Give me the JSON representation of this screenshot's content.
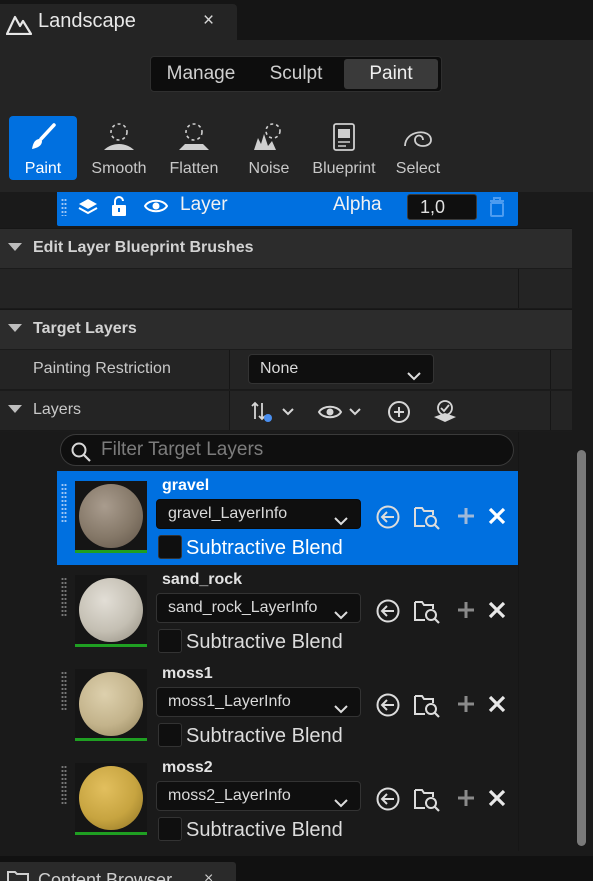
{
  "window": {
    "tab_title": "Landscape",
    "close_glyph": "×",
    "logo_icon": "unreal-logo-icon"
  },
  "modes": {
    "items": [
      "Manage",
      "Sculpt",
      "Paint"
    ],
    "active": "Paint"
  },
  "tools": {
    "items": [
      {
        "label": "Paint",
        "icon": "paint-brush-icon",
        "active": true
      },
      {
        "label": "Smooth",
        "icon": "smooth-icon",
        "active": false
      },
      {
        "label": "Flatten",
        "icon": "flatten-icon",
        "active": false
      },
      {
        "label": "Noise",
        "icon": "noise-icon",
        "active": false
      },
      {
        "label": "Blueprint",
        "icon": "blueprint-icon",
        "active": false
      },
      {
        "label": "Select",
        "icon": "select-icon",
        "active": false
      }
    ]
  },
  "edit_layer": {
    "name": "Layer",
    "alpha_label": "Alpha",
    "alpha_value": "1,0"
  },
  "sections": {
    "blueprint_brushes": "Edit Layer Blueprint Brushes",
    "target_layers": "Target Layers"
  },
  "painting_restriction": {
    "label": "Painting Restriction",
    "value": "None"
  },
  "layers_row": {
    "label": "Layers"
  },
  "search": {
    "placeholder": "Filter Target Layers"
  },
  "target_layers": [
    {
      "name": "gravel",
      "layer_info": "gravel_LayerInfo",
      "subtractive_label": "Subtractive Blend",
      "selected": true,
      "texture_color": "#8a7e72"
    },
    {
      "name": "sand_rock",
      "layer_info": "sand_rock_LayerInfo",
      "subtractive_label": "Subtractive Blend",
      "selected": false,
      "texture_color": "#c8c3b8"
    },
    {
      "name": "moss1",
      "layer_info": "moss1_LayerInfo",
      "subtractive_label": "Subtractive Blend",
      "selected": false,
      "texture_color": "#c9b890"
    },
    {
      "name": "moss2",
      "layer_info": "moss2_LayerInfo",
      "subtractive_label": "Subtractive Blend",
      "selected": false,
      "texture_color": "#c9a645"
    }
  ],
  "bottom_tab": {
    "title": "Content Browser",
    "close_glyph": "×"
  },
  "colors": {
    "accent": "#0070e0",
    "panel": "#242424",
    "section": "#2c2c2c",
    "field": "#0f0f0f",
    "green_bar": "#1f9f22"
  }
}
